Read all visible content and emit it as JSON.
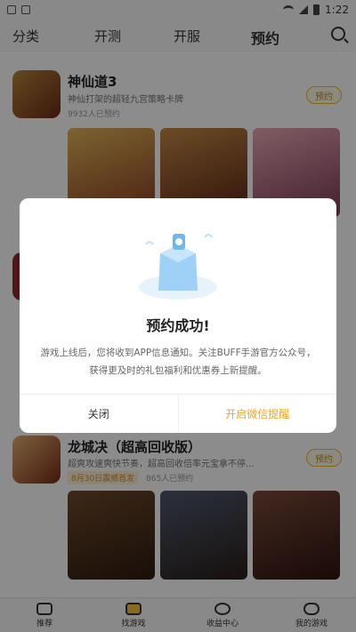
{
  "status_bar": {
    "time": "1:22"
  },
  "tabs": [
    {
      "label": "分类"
    },
    {
      "label": "开测"
    },
    {
      "label": "开服"
    },
    {
      "label": "预约",
      "active": true
    }
  ],
  "games": [
    {
      "title": "神仙道3",
      "desc": "神仙打架的超轻九宫策略卡牌",
      "count": "9932人已预约",
      "button": "预约"
    },
    {
      "title": "龙城决（超高回收版）",
      "desc": "超爽攻速爽快节奏，超高回收倍率元宝拿不停...",
      "tag": "8月30日震撼首发",
      "count": "865人已预约",
      "button": "预约"
    }
  ],
  "dialog": {
    "title": "预约成功!",
    "body": "游戏上线后，您将收到APP信息通知。关注BUFF手游官方公众号，获得更及时的礼包福利和优惠券上新提醒。",
    "close_label": "关闭",
    "wechat_label": "开启微信提醒"
  },
  "bottom_nav": [
    {
      "label": "推荐",
      "icon": "cup-icon"
    },
    {
      "label": "找游戏",
      "icon": "gamebox-icon",
      "active": true
    },
    {
      "label": "收益中心",
      "icon": "coin-icon"
    },
    {
      "label": "我的游戏",
      "icon": "controller-icon"
    }
  ]
}
